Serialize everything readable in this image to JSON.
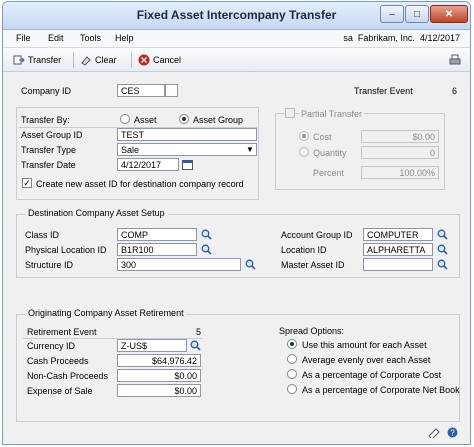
{
  "window": {
    "title": "Fixed Asset Intercompany Transfer",
    "minimize": "–",
    "maximize": "□",
    "close": "✕"
  },
  "menu": {
    "items": [
      "File",
      "Edit",
      "Tools",
      "Help"
    ],
    "user": "sa",
    "company": "Fabrikam, Inc.",
    "date": "4/12/2017"
  },
  "toolbar": {
    "transfer": "Transfer",
    "clear": "Clear",
    "cancel": "Cancel"
  },
  "header": {
    "company_id_label": "Company ID",
    "company_id_value": "CES",
    "transfer_event_label": "Transfer Event",
    "transfer_event_value": "6"
  },
  "transfer": {
    "transfer_by_label": "Transfer By:",
    "option_asset": "Asset",
    "option_asset_group": "Asset Group",
    "selected": "Asset Group",
    "asset_group_id_label": "Asset Group ID",
    "asset_group_id_value": "TEST",
    "transfer_type_label": "Transfer Type",
    "transfer_type_value": "Sale",
    "transfer_date_label": "Transfer Date",
    "transfer_date_value": "4/12/2017",
    "create_new_label": "Create new asset ID for destination company record",
    "create_new_checked": true
  },
  "partial": {
    "label": "Partial Transfer",
    "checked": false,
    "cost_label": "Cost",
    "cost_value": "$0.00",
    "quantity_label": "Quantity",
    "quantity_value": "0",
    "percent_label": "Percent",
    "percent_value": "100.00%"
  },
  "destination": {
    "title": "Destination Company Asset Setup",
    "class_id_label": "Class ID",
    "class_id_value": "COMP",
    "physical_location_label": "Physical Location ID",
    "physical_location_value": "B1R100",
    "structure_id_label": "Structure ID",
    "structure_id_value": "300",
    "account_group_label": "Account Group ID",
    "account_group_value": "COMPUTER",
    "location_id_label": "Location ID",
    "location_id_value": "ALPHARETTA",
    "master_asset_label": "Master Asset ID",
    "master_asset_value": ""
  },
  "originating": {
    "title": "Originating Company Asset Retirement",
    "retirement_event_label": "Retirement Event",
    "retirement_event_value": "5",
    "currency_id_label": "Currency ID",
    "currency_id_value": "Z-US$",
    "cash_proceeds_label": "Cash Proceeds",
    "cash_proceeds_value": "$64,976.42",
    "non_cash_label": "Non-Cash Proceeds",
    "non_cash_value": "$0.00",
    "expense_label": "Expense of Sale",
    "expense_value": "$0.00"
  },
  "spread": {
    "title": "Spread Options:",
    "options": [
      "Use this amount for each Asset",
      "Average evenly over each Asset",
      "As a percentage of Corporate Cost",
      "As a percentage of Corporate Net Book"
    ],
    "selected_index": 0
  },
  "colors": {
    "title_bar": "#c6d9f1",
    "close_button": "#c2442a",
    "lookup_icon": "#2a5fa8"
  }
}
